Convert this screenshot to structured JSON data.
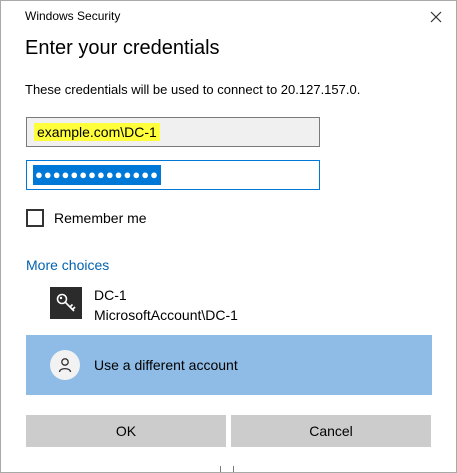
{
  "window": {
    "title": "Windows Security",
    "close_icon": "close-icon"
  },
  "dialog": {
    "heading": "Enter your credentials",
    "description": "These credentials will be used to connect to 20.127.157.0."
  },
  "username": {
    "value": "example.com\\DC-1",
    "highlight_color": "#ffff3b"
  },
  "password": {
    "value": "●●●●●●●●●●●●●●",
    "selection_color": "#0078d7"
  },
  "remember": {
    "label": "Remember me",
    "checked": false
  },
  "more_choices": {
    "label": "More choices",
    "color": "#0063b1"
  },
  "accounts": [
    {
      "icon": "key-icon",
      "name": "DC-1",
      "subtitle": "MicrosoftAccount\\DC-1"
    }
  ],
  "different_account": {
    "icon": "person-icon",
    "label": "Use a different account",
    "background": "#8fbce6"
  },
  "buttons": {
    "ok": "OK",
    "cancel": "Cancel"
  }
}
